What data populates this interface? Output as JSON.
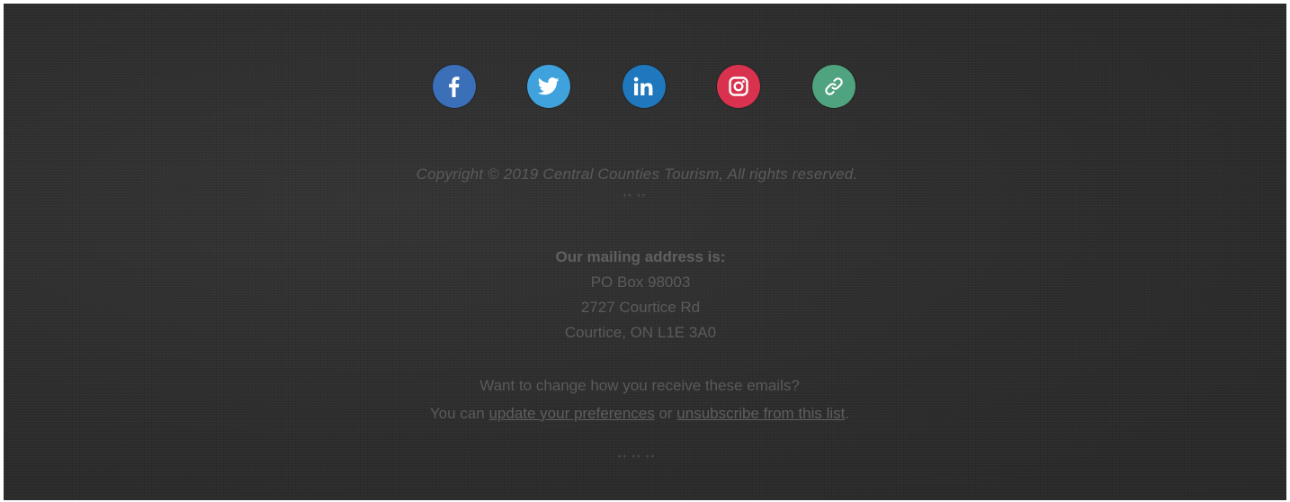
{
  "footer": {
    "social": [
      {
        "name": "facebook",
        "icon": "facebook-icon",
        "color": "#3b6fb8"
      },
      {
        "name": "twitter",
        "icon": "twitter-icon",
        "color": "#3fa2dd"
      },
      {
        "name": "linkedin",
        "icon": "linkedin-icon",
        "color": "#1f78bd"
      },
      {
        "name": "instagram",
        "icon": "instagram-icon",
        "color": "#d8324f"
      },
      {
        "name": "website",
        "icon": "link-icon",
        "color": "#4fa37e"
      }
    ],
    "copyright": "Copyright © 2019 Central Counties Tourism, All rights reserved.",
    "separator_1": "** **",
    "address": {
      "heading": "Our mailing address is:",
      "line1": "PO Box 98003",
      "line2": "2727 Courtice Rd",
      "line3": "Courtice, ON L1E 3A0"
    },
    "preferences": {
      "question": "Want to change how you receive these emails?",
      "prefix": "You can ",
      "update_link": "update your preferences",
      "middle": " or ",
      "unsubscribe_link": "unsubscribe from this list",
      "suffix": "."
    },
    "separator_2": "** ** **"
  }
}
